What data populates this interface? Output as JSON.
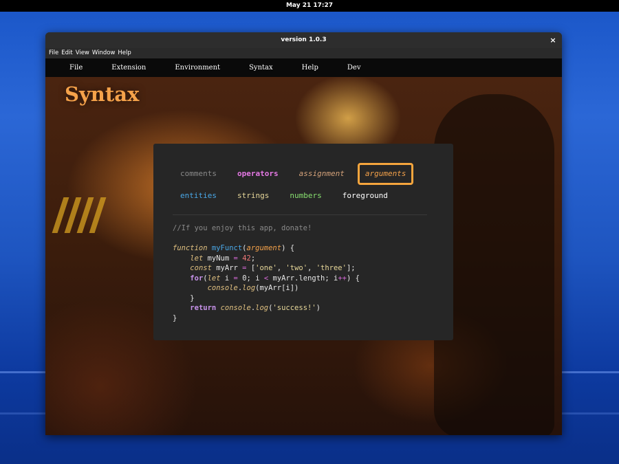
{
  "topbar": {
    "datetime": "May 21  17:27"
  },
  "window": {
    "title": "version 1.0.3",
    "close_glyph": "×"
  },
  "system_menu": [
    "File",
    "Edit",
    "View",
    "Window",
    "Help"
  ],
  "app_menu": [
    "File",
    "Extension",
    "Environment",
    "Syntax",
    "Help",
    "Dev"
  ],
  "page": {
    "title": "Syntax"
  },
  "syntax_categories": {
    "row1": [
      {
        "label": "comments",
        "color": "#8a8a8a"
      },
      {
        "label": "operators",
        "color": "#e478e4"
      },
      {
        "label": "assignment",
        "color": "#d4a27a"
      },
      {
        "label": "arguments",
        "color": "#f5a24a",
        "selected": true
      }
    ],
    "row2": [
      {
        "label": "entities",
        "color": "#4aa8e8"
      },
      {
        "label": "strings",
        "color": "#e8d89a"
      },
      {
        "label": "numbers",
        "color": "#88e070"
      },
      {
        "label": "foreground",
        "color": "#ffffff"
      }
    ]
  },
  "code_preview": {
    "comment": "//If you enjoy this app, donate!",
    "kw_function": "function",
    "fn_name": "myFunct",
    "arg": "argument",
    "kw_let": "let",
    "var_num": "myNum",
    "num_val": "42",
    "kw_const": "const",
    "var_arr": "myArr",
    "str_one": "'one'",
    "str_two": "'two'",
    "str_three": "'three'",
    "kw_for": "for",
    "var_i": "i",
    "zero": "0",
    "length": "length",
    "console": "console",
    "log": "log",
    "str_success": "'success!'",
    "kw_return": "return"
  },
  "colors": {
    "accent": "#f5a53d",
    "card_bg": "#262626",
    "menu_bg": "#0a0a0a"
  }
}
